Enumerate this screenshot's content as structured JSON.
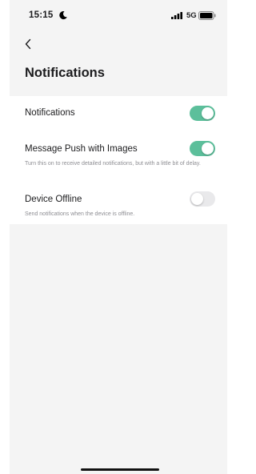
{
  "status_bar": {
    "time": "15:15",
    "network": "5G"
  },
  "header": {
    "title": "Notifications"
  },
  "settings": [
    {
      "label": "Notifications",
      "description": "",
      "enabled": true
    },
    {
      "label": "Message Push with Images",
      "description": "Turn this on to receive detailed notifications, but with a little bit of delay.",
      "enabled": true
    },
    {
      "label": "Device Offline",
      "description": "Send notifications when the device is offline.",
      "enabled": false
    }
  ],
  "colors": {
    "toggle_on": "#5cbf9b",
    "toggle_off": "#e9e9eb",
    "background": "#f4f4f4"
  }
}
